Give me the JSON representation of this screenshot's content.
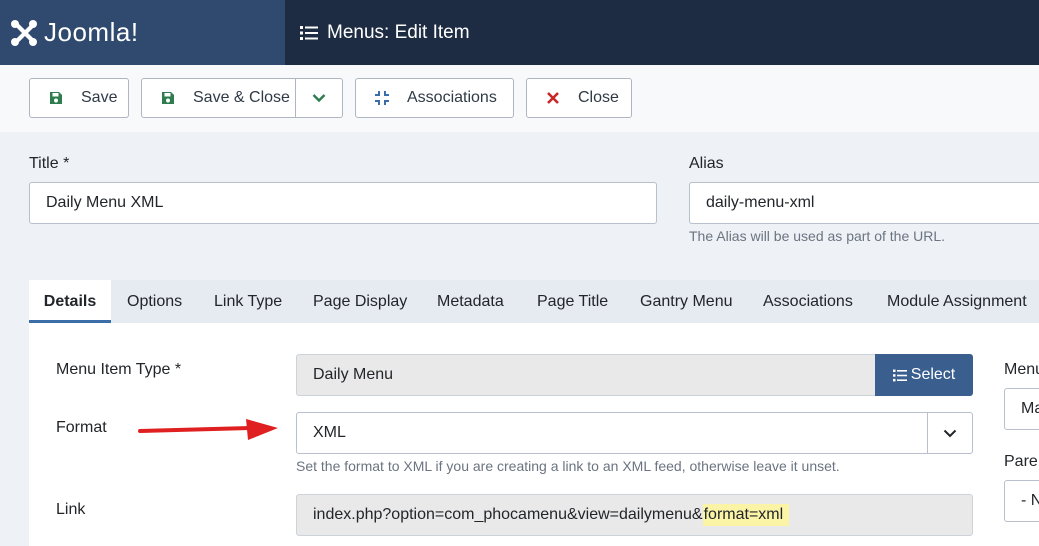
{
  "header": {
    "logo_text": "Joomla!",
    "page_title": "Menus: Edit Item"
  },
  "toolbar": {
    "save_label": "Save",
    "save_close_label": "Save & Close",
    "associations_label": "Associations",
    "close_label": "Close"
  },
  "form": {
    "title_label": "Title *",
    "title_value": "Daily Menu XML",
    "alias_label": "Alias",
    "alias_value": "daily-menu-xml",
    "alias_help": "The Alias will be used as part of the URL."
  },
  "tabs": [
    {
      "label": "Details",
      "active": true
    },
    {
      "label": "Options"
    },
    {
      "label": "Link Type"
    },
    {
      "label": "Page Display"
    },
    {
      "label": "Metadata"
    },
    {
      "label": "Page Title"
    },
    {
      "label": "Gantry Menu"
    },
    {
      "label": "Associations"
    },
    {
      "label": "Module Assignment"
    }
  ],
  "details": {
    "menu_item_type_label": "Menu Item Type *",
    "menu_item_type_value": "Daily Menu",
    "select_label": "Select",
    "format_label": "Format",
    "format_value": "XML",
    "format_help": "Set the format to XML if you are creating a link to an XML feed, otherwise leave it unset.",
    "link_label": "Link",
    "link_value_prefix": "index.php?option=com_phocamenu&view=dailymenu&",
    "link_value_highlight": "format=xml",
    "right_menu_label": "Menu",
    "right_menu_value": "Ma",
    "right_parent_label": "Pare",
    "right_parent_value": "- N"
  },
  "colors": {
    "header_bg": "#1d2c42",
    "logo_bg": "#2f4a6e",
    "primary": "#3a5f8f",
    "save_icon": "#2e7d4f",
    "close_icon": "#c62828",
    "arrow": "#e02020",
    "highlight": "#fbf4a6"
  }
}
